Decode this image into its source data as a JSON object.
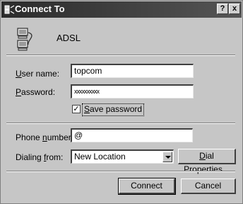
{
  "window": {
    "title": "Connect To",
    "help_label": "?",
    "close_label": "x"
  },
  "connection": {
    "name": "ADSL",
    "icon": "dialup-connection-icon"
  },
  "form": {
    "username_label_key": "U",
    "username_label_rest": "ser name:",
    "username_value": "topcom",
    "password_label_key": "P",
    "password_label_rest": "assword:",
    "password_value": "xxxxxxxxxx",
    "save_password_key": "S",
    "save_password_rest": "ave password",
    "save_password_checked": true,
    "phone_label_pre": "Phone ",
    "phone_label_key": "n",
    "phone_label_rest": "umber:",
    "phone_value": "@",
    "dialing_label_pre": "Dialing ",
    "dialing_label_key": "f",
    "dialing_label_rest": "rom:",
    "dialing_value": "New Location",
    "dial_props_key": "D",
    "dial_props_rest": "ial Properties..."
  },
  "buttons": {
    "connect": "Connect",
    "cancel": "Cancel"
  }
}
